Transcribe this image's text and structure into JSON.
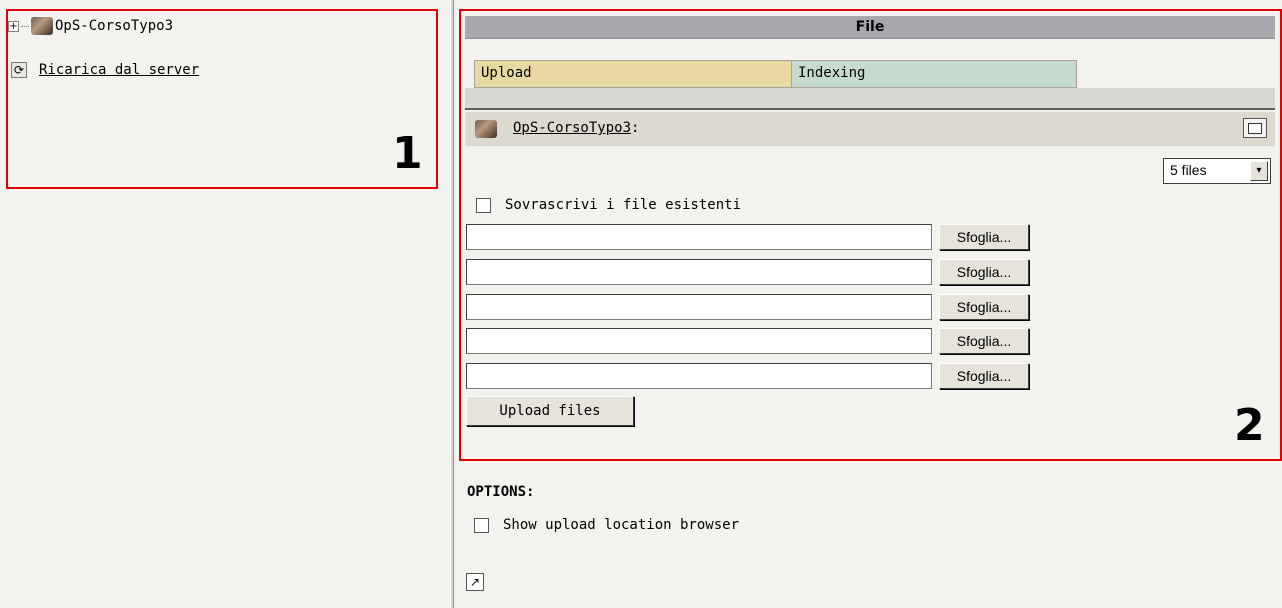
{
  "tree": {
    "root_label": "OpS-CorsoTypo3",
    "reload_label": "Ricarica dal server",
    "expand_glyph": "+",
    "refresh_glyph": "⟳"
  },
  "annotations": {
    "box1": "1",
    "box2": "2"
  },
  "panel": {
    "title": "File",
    "tabs": [
      {
        "label": "Upload",
        "color": "#e8d9a2"
      },
      {
        "label": "Indexing",
        "color": "#c5dbd0"
      }
    ],
    "path_label": "OpS-CorsoTypo3",
    "path_suffix": ":",
    "files_select": "5 files",
    "select_arrow": "▾",
    "overwrite_label": "Sovrascrivi i file esistenti",
    "browse_labels": [
      "Sfoglia...",
      "Sfoglia...",
      "Sfoglia...",
      "Sfoglia...",
      "Sfoglia..."
    ],
    "upload_button": "Upload files"
  },
  "options": {
    "heading": "OPTIONS:",
    "show_browser_label": "Show upload location browser",
    "corner_glyph": "↗"
  },
  "colors": {
    "annotation_border": "#e0000a",
    "header_bg": "#a8a8ae"
  }
}
